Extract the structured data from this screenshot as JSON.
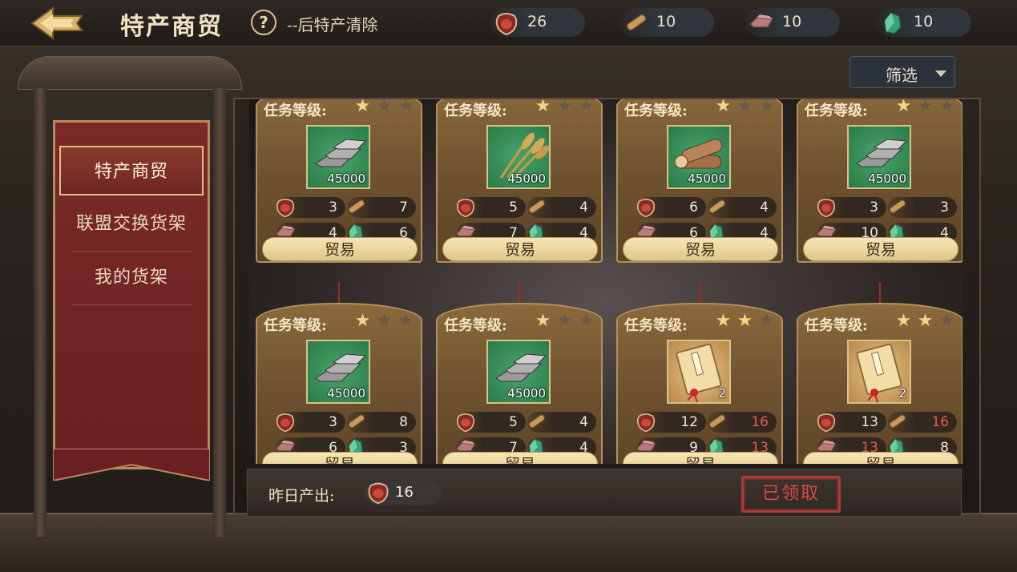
{
  "header": {
    "title": "特产商贸",
    "help_symbol": "?",
    "help_text": "--后特产清除"
  },
  "resources": [
    {
      "name": "specialty-jar",
      "value": "26"
    },
    {
      "name": "wood-log",
      "value": "10"
    },
    {
      "name": "iron-ingot",
      "value": "10"
    },
    {
      "name": "jade-ore",
      "value": "10"
    }
  ],
  "filter": {
    "label": "筛选"
  },
  "sidebar": {
    "items": [
      {
        "label": "特产商贸",
        "active": true
      },
      {
        "label": "联盟交换货架",
        "active": false
      },
      {
        "label": "我的货架",
        "active": false
      }
    ]
  },
  "cards": [
    {
      "level_label": "任务等级:",
      "stars": 1,
      "item": "silver-ingot",
      "amount": "45000",
      "costs": {
        "jar": "3",
        "wood": "7",
        "iron": "4",
        "jade": "6"
      },
      "trade": "贸易"
    },
    {
      "level_label": "任务等级:",
      "stars": 1,
      "item": "wheat",
      "amount": "45000",
      "costs": {
        "jar": "5",
        "wood": "4",
        "iron": "7",
        "jade": "4"
      },
      "trade": "贸易"
    },
    {
      "level_label": "任务等级:",
      "stars": 1,
      "item": "logs",
      "amount": "45000",
      "costs": {
        "jar": "6",
        "wood": "4",
        "iron": "6",
        "jade": "4"
      },
      "trade": "贸易"
    },
    {
      "level_label": "任务等级:",
      "stars": 1,
      "item": "silver-ingot",
      "amount": "45000",
      "costs": {
        "jar": "3",
        "wood": "3",
        "iron": "10",
        "jade": "4"
      },
      "trade": "贸易"
    },
    {
      "level_label": "任务等级:",
      "stars": 1,
      "item": "silver-ingot",
      "amount": "45000",
      "costs": {
        "jar": "3",
        "wood": "8",
        "iron": "6",
        "jade": "3"
      },
      "trade": "贸易"
    },
    {
      "level_label": "任务等级:",
      "stars": 1,
      "item": "silver-ingot",
      "amount": "45000",
      "costs": {
        "jar": "5",
        "wood": "4",
        "iron": "7",
        "jade": "4"
      },
      "trade": "贸易"
    },
    {
      "level_label": "任务等级:",
      "stars": 2,
      "item": "scroll-book",
      "amount": "2",
      "costs": {
        "jar": "12",
        "wood": "16",
        "iron": "9",
        "jade": "13"
      },
      "red": [
        "wood",
        "jade"
      ],
      "trade": "贸易"
    },
    {
      "level_label": "任务等级:",
      "stars": 2,
      "item": "scroll-book",
      "amount": "2",
      "costs": {
        "jar": "13",
        "wood": "16",
        "iron": "13",
        "jade": "8"
      },
      "red": [
        "wood",
        "iron"
      ],
      "trade": "贸易"
    }
  ],
  "footer": {
    "yesterday_label": "昨日产出:",
    "yesterday_value": "16",
    "claimed_stamp": "已领取"
  },
  "colors": {
    "accent_gold": "#e0c688",
    "insufficient_red": "#e85a50",
    "banner_red": "#7a2a28"
  }
}
